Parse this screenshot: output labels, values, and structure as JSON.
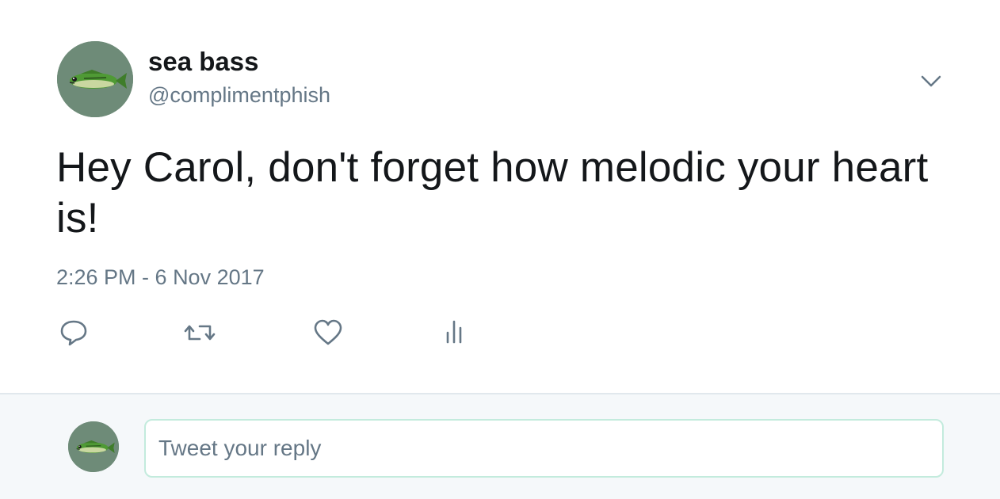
{
  "tweet": {
    "display_name": "sea bass",
    "handle": "@complimentphish",
    "text": "Hey Carol, don't forget how melodic your heart is!",
    "timestamp": "2:26 PM - 6 Nov 2017"
  },
  "actions": [
    {
      "name": "reply",
      "icon": "reply-icon"
    },
    {
      "name": "retweet",
      "icon": "retweet-icon"
    },
    {
      "name": "like",
      "icon": "heart-icon"
    },
    {
      "name": "analytics",
      "icon": "analytics-icon"
    }
  ],
  "reply": {
    "placeholder": "Tweet your reply"
  },
  "colors": {
    "text_primary": "#14171a",
    "text_secondary": "#657786",
    "reply_bar_bg": "#f5f8fa",
    "input_border": "#c3ebdd",
    "avatar_bg": "#6e8b78"
  }
}
